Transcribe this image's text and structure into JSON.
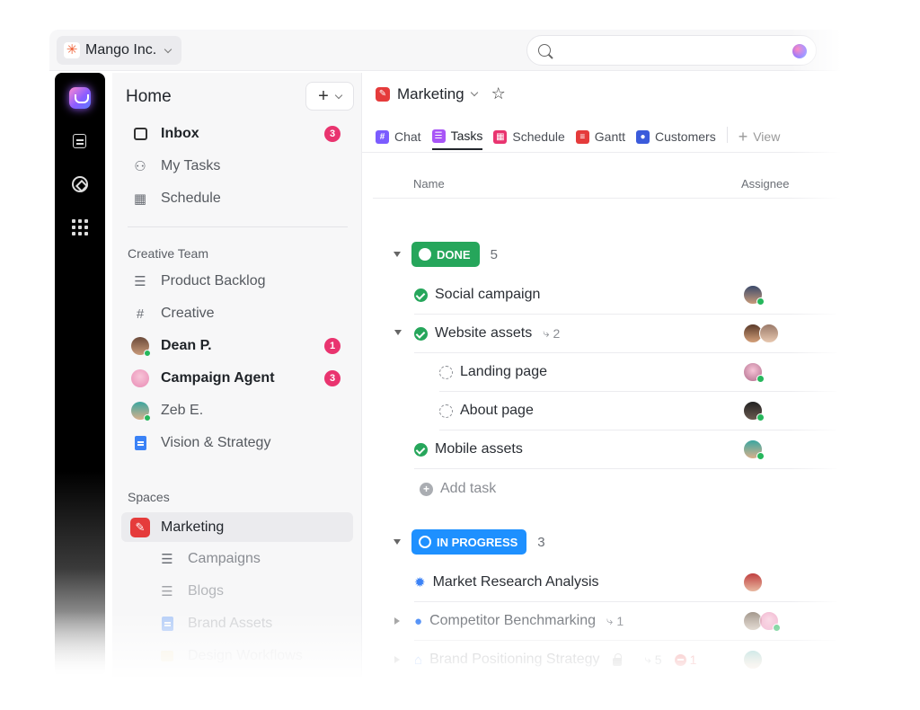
{
  "topbar": {
    "workspace_name": "Mango Inc.",
    "search_placeholder": ""
  },
  "rail": {
    "icons": [
      "home-icon",
      "inbox-icon",
      "ai-brain-icon",
      "apps-grid-icon"
    ]
  },
  "sidebar": {
    "title": "Home",
    "new_button_label": "+",
    "top_items": [
      {
        "label": "Inbox",
        "icon": "inbox-icon",
        "badge": "3"
      },
      {
        "label": "My Tasks",
        "icon": "user-check-icon"
      },
      {
        "label": "Schedule",
        "icon": "calendar-icon"
      }
    ],
    "creative_team": {
      "title": "Creative Team",
      "items": [
        {
          "label": "Product Backlog",
          "icon": "list-icon"
        },
        {
          "label": "Creative",
          "icon": "hash-icon"
        },
        {
          "label": "Dean P.",
          "icon": "avatar",
          "badge": "1"
        },
        {
          "label": "Campaign Agent",
          "icon": "avatar",
          "badge": "3"
        },
        {
          "label": "Zeb E.",
          "icon": "avatar"
        },
        {
          "label": "Vision & Strategy",
          "icon": "doc-icon"
        }
      ]
    },
    "spaces": {
      "title": "Spaces",
      "items": [
        {
          "label": "Marketing",
          "icon": "space-icon"
        },
        {
          "label": "Campaigns",
          "icon": "list-icon"
        },
        {
          "label": "Blogs",
          "icon": "list-icon"
        },
        {
          "label": "Brand Assets",
          "icon": "doc-icon"
        },
        {
          "label": "Design Workflows",
          "icon": "folder-icon"
        }
      ]
    }
  },
  "main": {
    "space_title": "Marketing",
    "tabs": [
      {
        "label": "Chat",
        "icon": "hash-icon",
        "color": "#7b5cff"
      },
      {
        "label": "Tasks",
        "icon": "list-icon",
        "color": "#a855f7"
      },
      {
        "label": "Schedule",
        "icon": "calendar-icon",
        "color": "#e9346f"
      },
      {
        "label": "Gantt",
        "icon": "gantt-icon",
        "color": "#e53b3b"
      },
      {
        "label": "Customers",
        "icon": "people-icon",
        "color": "#3b5bdb"
      }
    ],
    "add_view_label": "View",
    "columns": {
      "name": "Name",
      "assignee": "Assignee"
    },
    "groups": [
      {
        "status": "DONE",
        "color": "#26a65b",
        "count": "5",
        "tasks": [
          {
            "name": "Social campaign",
            "status": "done"
          },
          {
            "name": "Website assets",
            "status": "done",
            "subtasks": "2"
          },
          {
            "name": "Landing page",
            "status": "todo"
          },
          {
            "name": "About page",
            "status": "todo"
          },
          {
            "name": "Mobile assets",
            "status": "done"
          }
        ],
        "add_task_label": "Add task"
      },
      {
        "status": "IN PROGRESS",
        "color": "#1e90ff",
        "count": "3",
        "tasks": [
          {
            "name": "Market Research Analysis",
            "icon": "bug-icon"
          },
          {
            "name": "Competitor Benchmarking",
            "icon": "person-icon",
            "subtasks": "1"
          },
          {
            "name": "Brand Positioning Strategy",
            "icon": "home-icon",
            "subtasks": "5",
            "blocked": "1"
          }
        ]
      }
    ]
  }
}
